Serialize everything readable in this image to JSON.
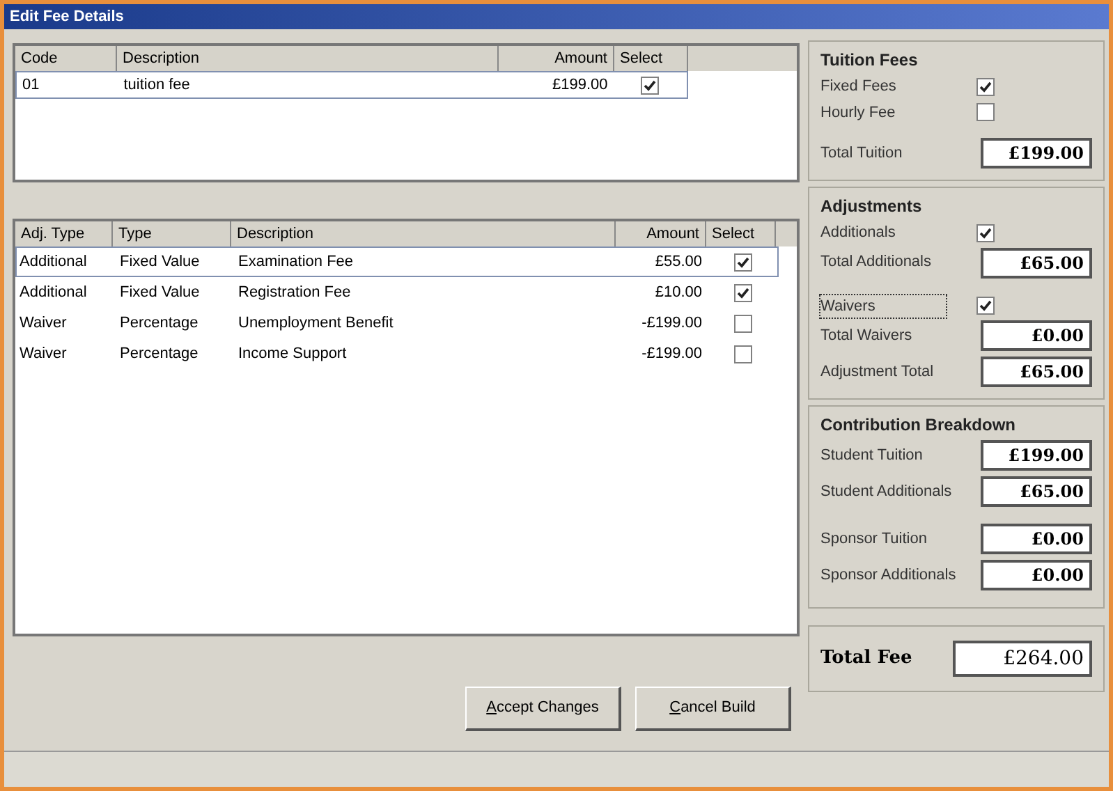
{
  "window": {
    "title": "Edit Fee Details"
  },
  "fee_table": {
    "columns": [
      "Code",
      "Description",
      "Amount",
      "Select"
    ],
    "rows": [
      {
        "code": "01",
        "description": "tuition fee",
        "amount": "£199.00",
        "checked": true,
        "selected": true
      }
    ]
  },
  "adjustment_table": {
    "columns": [
      "Adj. Type",
      "Type",
      "Description",
      "Amount",
      "Select"
    ],
    "rows": [
      {
        "adj_type": "Additional",
        "type": "Fixed Value",
        "description": "Examination Fee",
        "amount": "£55.00",
        "checked": true,
        "selected": true
      },
      {
        "adj_type": "Additional",
        "type": "Fixed Value",
        "description": "Registration Fee",
        "amount": "£10.00",
        "checked": true,
        "selected": false
      },
      {
        "adj_type": "Waiver",
        "type": "Percentage",
        "description": "Unemployment Benefit",
        "amount": "-£199.00",
        "checked": false,
        "selected": false
      },
      {
        "adj_type": "Waiver",
        "type": "Percentage",
        "description": "Income Support",
        "amount": "-£199.00",
        "checked": false,
        "selected": false
      }
    ]
  },
  "tuition_fees": {
    "title": "Tuition Fees",
    "options": [
      {
        "label": "Fixed Fees",
        "checked": true
      },
      {
        "label": "Hourly Fee",
        "checked": false
      }
    ],
    "total": {
      "label": "Total Tuition",
      "value": "£199.00"
    }
  },
  "adjustments": {
    "title": "Adjustments",
    "additionals": {
      "label": "Additionals",
      "checked": true,
      "focused": false
    },
    "total_additionals": {
      "label": "Total Additionals",
      "value": "£65.00"
    },
    "waivers": {
      "label": "Waivers",
      "checked": true,
      "focused": true
    },
    "total_waivers": {
      "label": "Total Waivers",
      "value": "£0.00"
    },
    "adjustment_total": {
      "label": "Adjustment Total",
      "value": "£65.00"
    }
  },
  "contribution": {
    "title": "Contribution Breakdown",
    "fields": [
      {
        "label": "Student Tuition",
        "value": "£199.00"
      },
      {
        "label": "Student Additionals",
        "value": "£65.00"
      },
      {
        "label": "Sponsor Tuition",
        "value": "£0.00"
      },
      {
        "label": "Sponsor Additionals",
        "value": "£0.00"
      }
    ]
  },
  "total_fee": {
    "label": "Total Fee",
    "value": "£264.00"
  },
  "buttons": [
    {
      "label": "Accept Changes"
    },
    {
      "label": "Cancel Build"
    }
  ]
}
